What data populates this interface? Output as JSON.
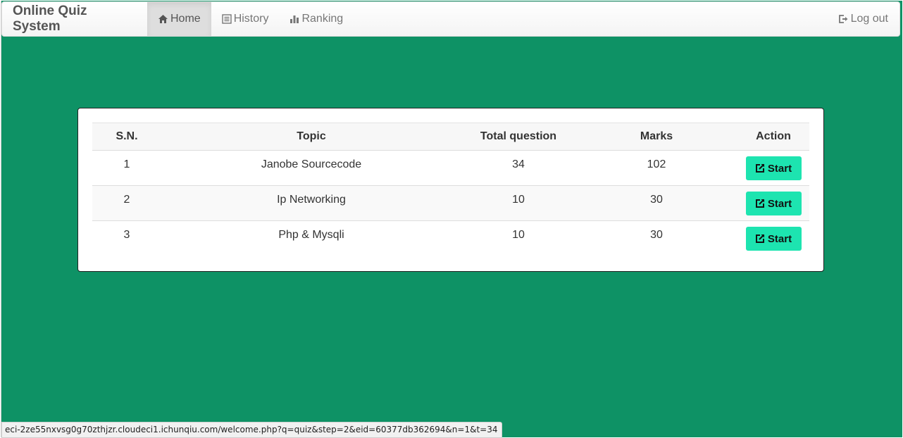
{
  "navbar": {
    "brand": "Online Quiz System",
    "items": [
      {
        "label": "Home",
        "icon": "home-icon",
        "active": true
      },
      {
        "label": "History",
        "icon": "list-icon",
        "active": false
      },
      {
        "label": "Ranking",
        "icon": "bar-chart-icon",
        "active": false
      }
    ],
    "logout": {
      "label": "Log out",
      "icon": "logout-icon"
    }
  },
  "table": {
    "headers": [
      "S.N.",
      "Topic",
      "Total question",
      "Marks",
      "Action"
    ],
    "rows": [
      {
        "sn": "1",
        "topic": "Janobe Sourcecode",
        "total": "34",
        "marks": "102",
        "action": "Start"
      },
      {
        "sn": "2",
        "topic": "Ip Networking",
        "total": "10",
        "marks": "30",
        "action": "Start"
      },
      {
        "sn": "3",
        "topic": "Php & Mysqli",
        "total": "10",
        "marks": "30",
        "action": "Start"
      }
    ]
  },
  "status_url": "eci-2ze55nxvsg0g70zthjzr.cloudeci1.ichunqiu.com/welcome.php?q=quiz&step=2&eid=60377db362694&n=1&t=34",
  "colors": {
    "page_background": "#0e9265",
    "start_button": "#1de4b0"
  }
}
